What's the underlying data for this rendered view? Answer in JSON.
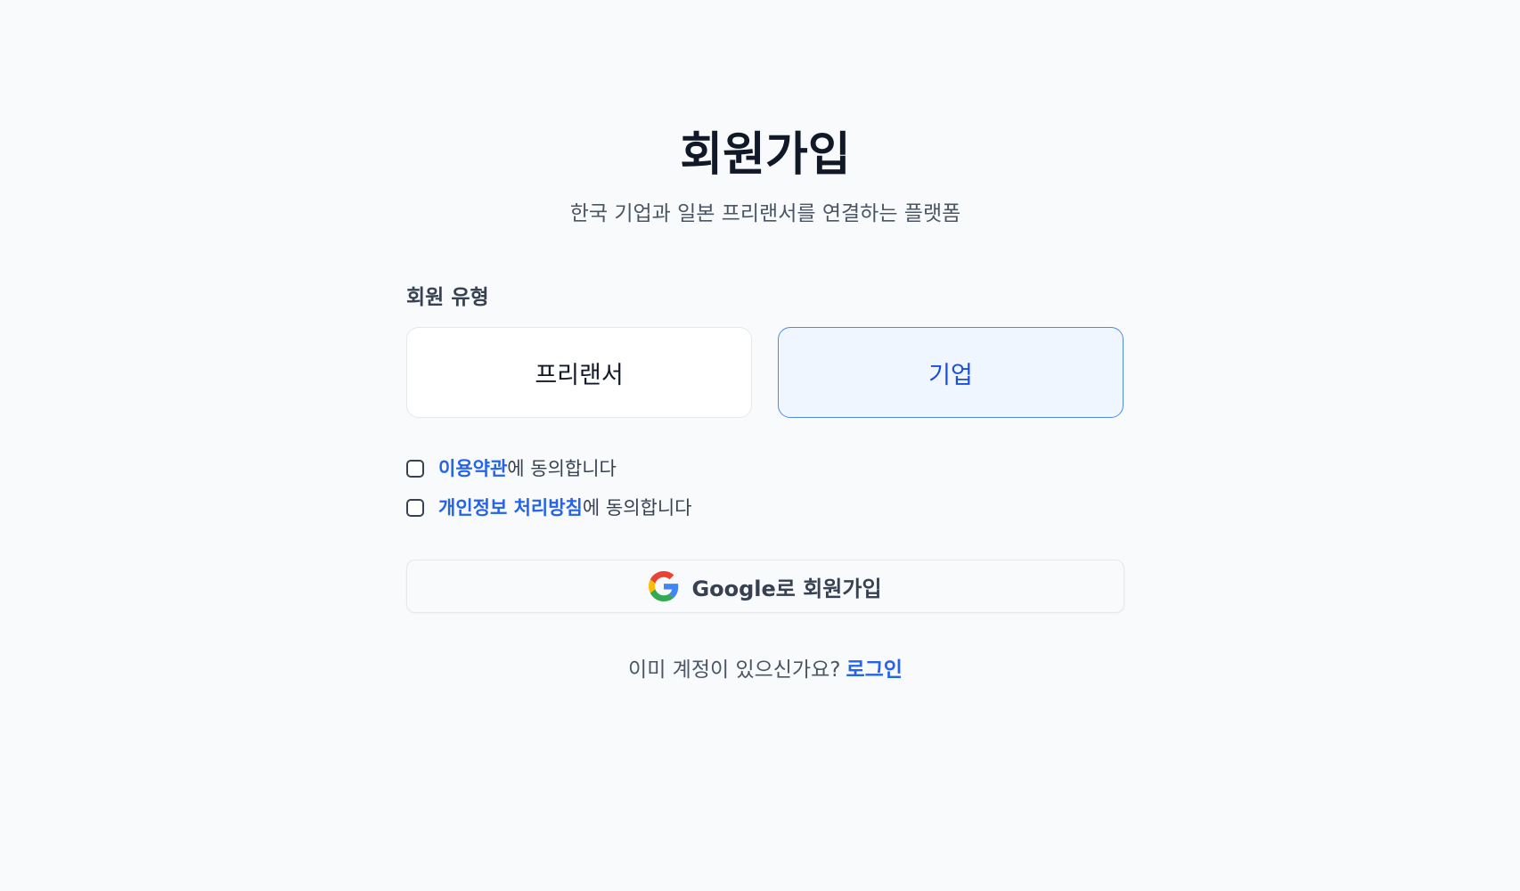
{
  "header": {
    "title": "회원가입",
    "subtitle": "한국 기업과 일본 프리랜서를 연결하는 플랫폼"
  },
  "member_type": {
    "label": "회원 유형",
    "options": [
      {
        "label": "프리랜서",
        "selected": false
      },
      {
        "label": "기업",
        "selected": true
      }
    ]
  },
  "agreements": {
    "terms_link": "이용약관",
    "terms_suffix": "에 동의합니다",
    "privacy_link": "개인정보 처리방침",
    "privacy_suffix": "에 동의합니다"
  },
  "google_signup": {
    "label": "Google로 회원가입",
    "icon": "google-icon"
  },
  "footer": {
    "question": "이미 계정이 있으신가요?",
    "login_link": "로그인"
  },
  "colors": {
    "background": "#f8fafc",
    "accent": "#2563eb",
    "selected_border": "#4f8ae8",
    "selected_bg": "#eff6ff"
  }
}
